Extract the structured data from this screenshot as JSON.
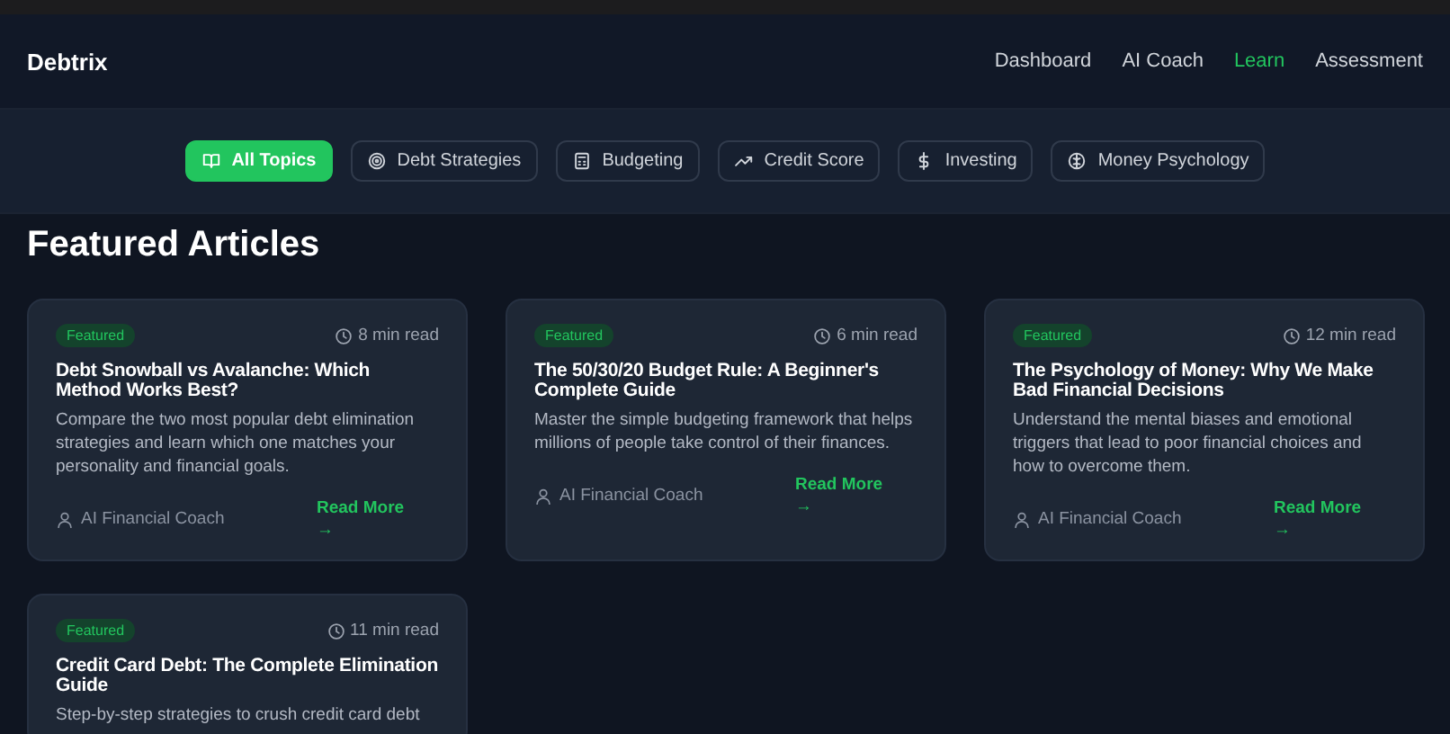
{
  "header": {
    "brand": "Debtrix",
    "nav": [
      {
        "label": "Dashboard",
        "selected": false
      },
      {
        "label": "AI Coach",
        "selected": false
      },
      {
        "label": "Learn",
        "selected": true
      },
      {
        "label": "Assessment",
        "selected": false
      }
    ]
  },
  "topics": [
    {
      "label": "All Topics",
      "selected": true
    },
    {
      "label": "Debt Strategies",
      "selected": false
    },
    {
      "label": "Budgeting",
      "selected": false
    },
    {
      "label": "Credit Score",
      "selected": false
    },
    {
      "label": "Investing",
      "selected": false
    },
    {
      "label": "Money Psychology",
      "selected": false
    }
  ],
  "section_title": "Featured Articles",
  "articles": [
    {
      "badge": "Featured",
      "read_time": "8 min read",
      "title": "Debt Snowball vs Avalanche: Which Method Works Best?",
      "description": "Compare the two most popular debt elimination strategies and learn which one matches your personality and financial goals.",
      "author": "AI Financial Coach",
      "link": "Read More",
      "arrow": "→"
    },
    {
      "badge": "Featured",
      "read_time": "6 min read",
      "title": "The 50/30/20 Budget Rule: A Beginner's Complete Guide",
      "description": "Master the simple budgeting framework that helps millions of people take control of their finances.",
      "author": "AI Financial Coach",
      "link": "Read More",
      "arrow": "→"
    },
    {
      "badge": "Featured",
      "read_time": "12 min read",
      "title": "The Psychology of Money: Why We Make Bad Financial Decisions",
      "description": "Understand the mental biases and emotional triggers that lead to poor financial choices and how to overcome them.",
      "author": "AI Financial Coach",
      "link": "Read More",
      "arrow": "→"
    },
    {
      "badge": "Featured",
      "read_time": "11 min read",
      "title": "Credit Card Debt: The Complete Elimination Guide",
      "description": "Step-by-step strategies to crush credit card debt"
    }
  ]
}
